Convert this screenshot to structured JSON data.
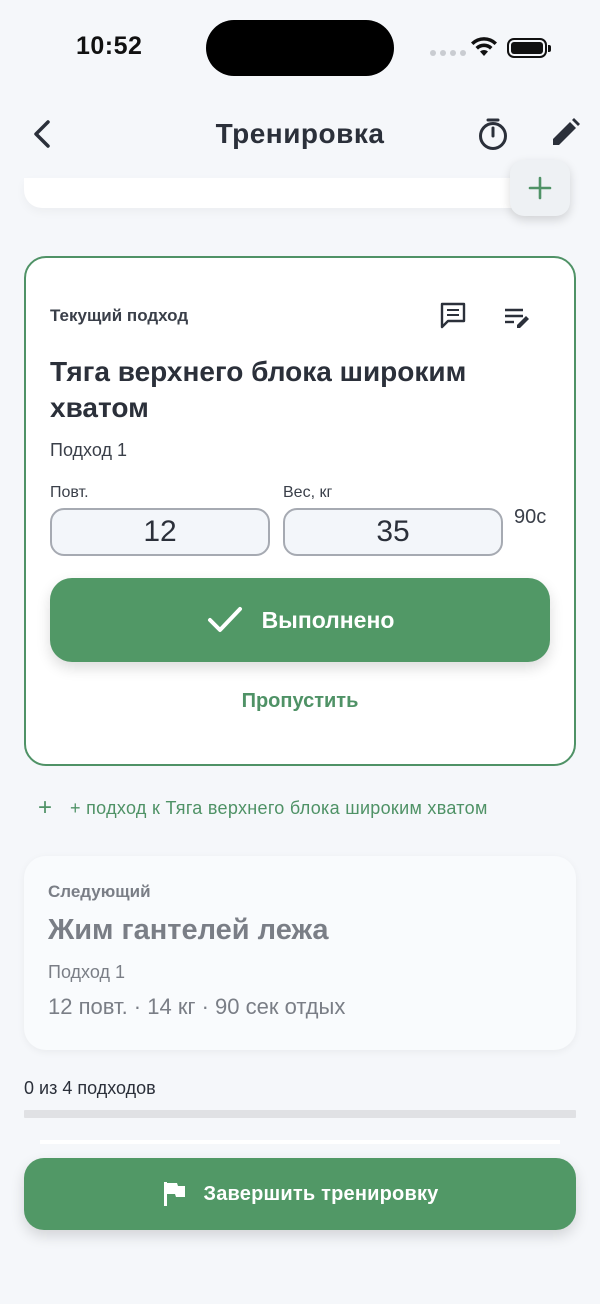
{
  "status_bar": {
    "time": "10:52"
  },
  "nav": {
    "title": "Тренировка"
  },
  "current": {
    "label": "Текущий подход",
    "exercise": "Тяга верхнего блока широким хватом",
    "set": "Подход 1",
    "reps_label": "Повт.",
    "weight_label": "Вес, кг",
    "reps_value": "12",
    "weight_value": "35",
    "rest": "90с",
    "done_label": "Выполнено",
    "skip_label": "Пропустить"
  },
  "add_set": {
    "plus": "+",
    "label": "+ подход к Тяга верхнего блока широким хватом"
  },
  "next": {
    "label": "Следующий",
    "exercise": "Жим гантелей лежа",
    "set": "Подход 1",
    "details": "12 повт. · 14 кг · 90 сек отдых"
  },
  "progress": {
    "text": "0 из 4 подходов",
    "fraction": 0
  },
  "finish": {
    "label": "Завершить тренировку"
  },
  "colors": {
    "accent": "#519866",
    "border": "#4f9266",
    "text": "#2b303a",
    "muted": "#7a7e86"
  },
  "icons": [
    "back-icon",
    "timer-icon",
    "edit-icon",
    "plus-icon",
    "comment-icon",
    "notes-edit-icon",
    "check-icon",
    "flag-icon"
  ]
}
